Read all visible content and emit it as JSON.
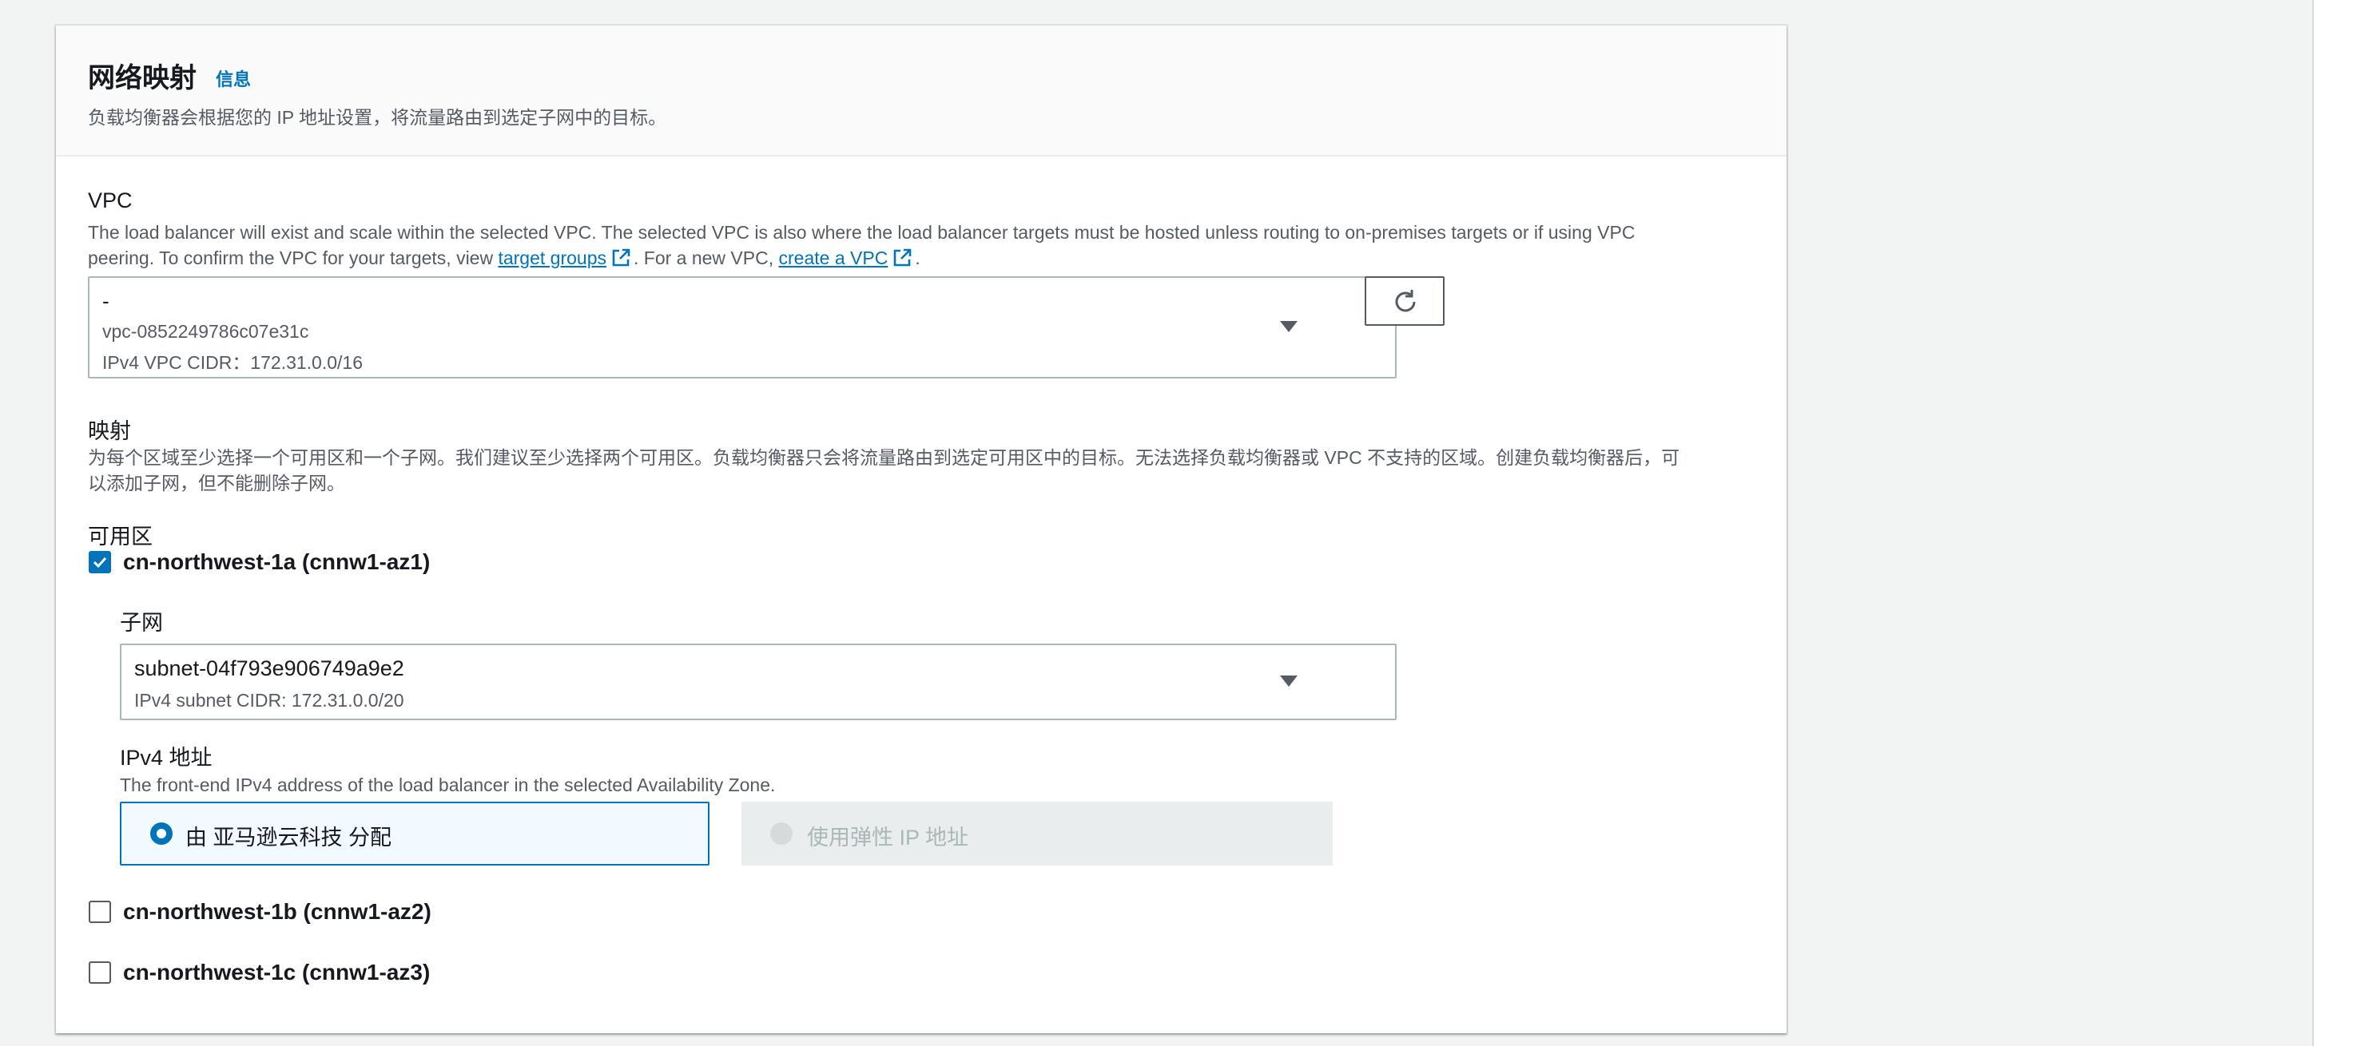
{
  "header": {
    "title": "网络映射",
    "info_link": "信息",
    "description": "负载均衡器会根据您的 IP 地址设置，将流量路由到选定子网中的目标。"
  },
  "vpc": {
    "label": "VPC",
    "description_line1": "The load balancer will exist and scale within the selected VPC. The selected VPC is also where the load balancer targets must be hosted unless routing to on-premises targets or if using VPC",
    "description_line2_prefix": "peering. To confirm the VPC for your targets, view ",
    "target_groups_link": "target groups",
    "description_mid": ". For a new VPC, ",
    "create_vpc_link": "create a VPC",
    "description_end": ".",
    "selected": {
      "name": "-",
      "id": "vpc-0852249786c07e31c",
      "cidr": "IPv4 VPC CIDR：172.31.0.0/16"
    }
  },
  "mappings": {
    "label": "映射",
    "description_line1": "为每个区域至少选择一个可用区和一个子网。我们建议至少选择两个可用区。负载均衡器只会将流量路由到选定可用区中的目标。无法选择负载均衡器或 VPC 不支持的区域。创建负载均衡器后，可",
    "description_line2": "以添加子网，但不能删除子网。",
    "az_heading": "可用区",
    "zones": [
      {
        "label": "cn-northwest-1a (cnnw1-az1)",
        "checked": true,
        "subnet_label": "子网",
        "subnet_id": "subnet-04f793e906749a9e2",
        "subnet_cidr": "IPv4 subnet CIDR: 172.31.0.0/20",
        "ipv4_label": "IPv4 地址",
        "ipv4_description": "The front-end IPv4 address of the load balancer in the selected Availability Zone.",
        "option_assigned": "由 亚马逊云科技 分配",
        "option_elastic": "使用弹性 IP 地址"
      },
      {
        "label": "cn-northwest-1b (cnnw1-az2)",
        "checked": false
      },
      {
        "label": "cn-northwest-1c (cnnw1-az3)",
        "checked": false
      }
    ]
  },
  "colors": {
    "accent": "#0073bb",
    "selected_tile_bg": "#f1faff",
    "disabled_bg": "#eaeded",
    "page_bg": "#f2f3f3"
  }
}
